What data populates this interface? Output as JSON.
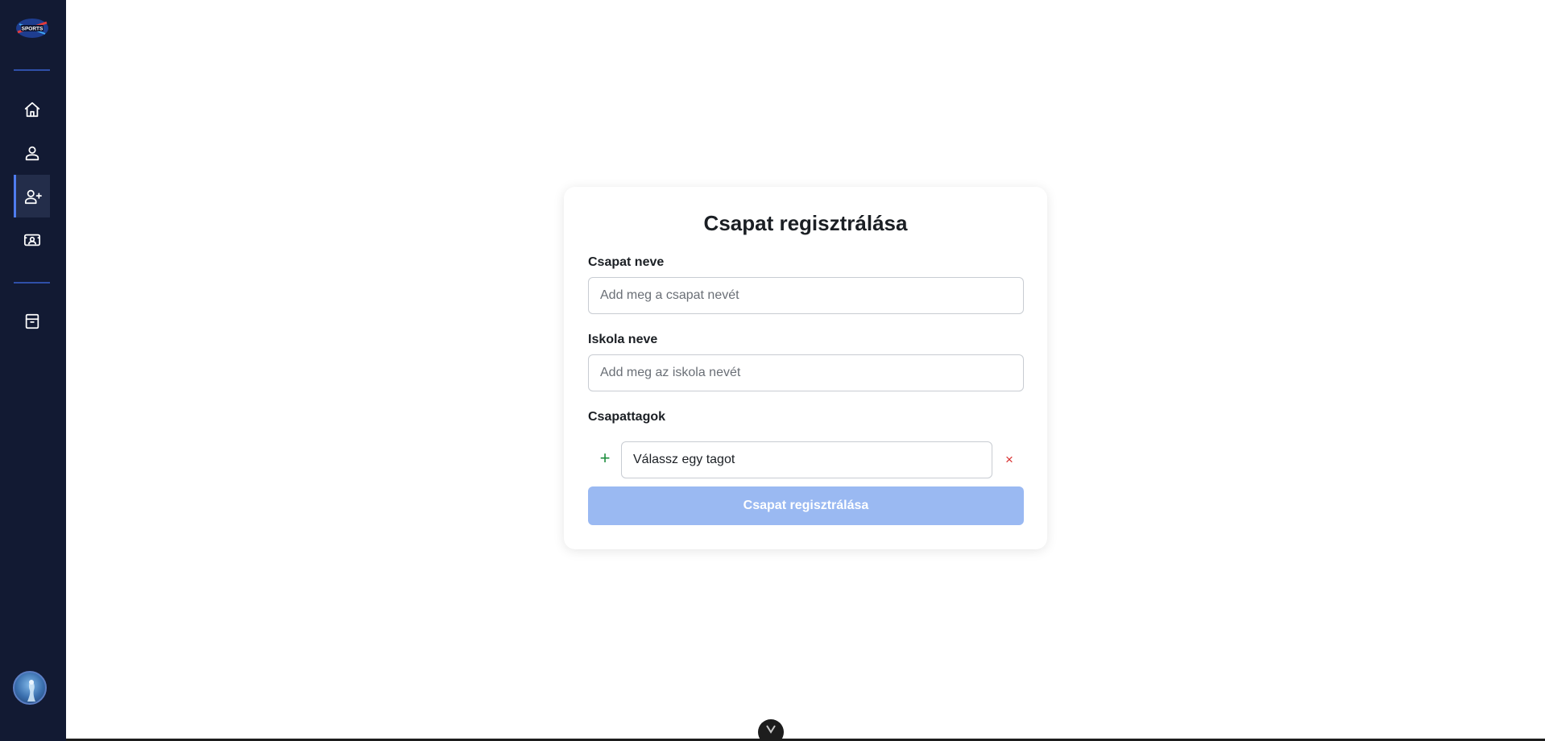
{
  "sidebar": {
    "logo_text": "SPORTS",
    "items": [
      {
        "name": "home",
        "icon": "home-icon"
      },
      {
        "name": "profile",
        "icon": "user-icon"
      },
      {
        "name": "team-registration",
        "icon": "user-plus-icon",
        "active": true
      },
      {
        "name": "id-card",
        "icon": "id-card-icon"
      },
      {
        "name": "archive",
        "icon": "archive-icon"
      }
    ],
    "accent_color": "#4f7df0",
    "background_color": "#121a33"
  },
  "form": {
    "title": "Csapat regisztrálása",
    "team_name_label": "Csapat neve",
    "team_name_placeholder": "Add meg a csapat nevét",
    "team_name_value": "",
    "school_name_label": "Iskola neve",
    "school_name_placeholder": "Add meg az iskola nevét",
    "school_name_value": "",
    "members_label": "Csapattagok",
    "add_member_symbol": "+",
    "member_select_value": "Válassz egy tagot",
    "remove_member_symbol": "×",
    "submit_label": "Csapat regisztrálása",
    "submit_color": "#9ab9f2"
  }
}
